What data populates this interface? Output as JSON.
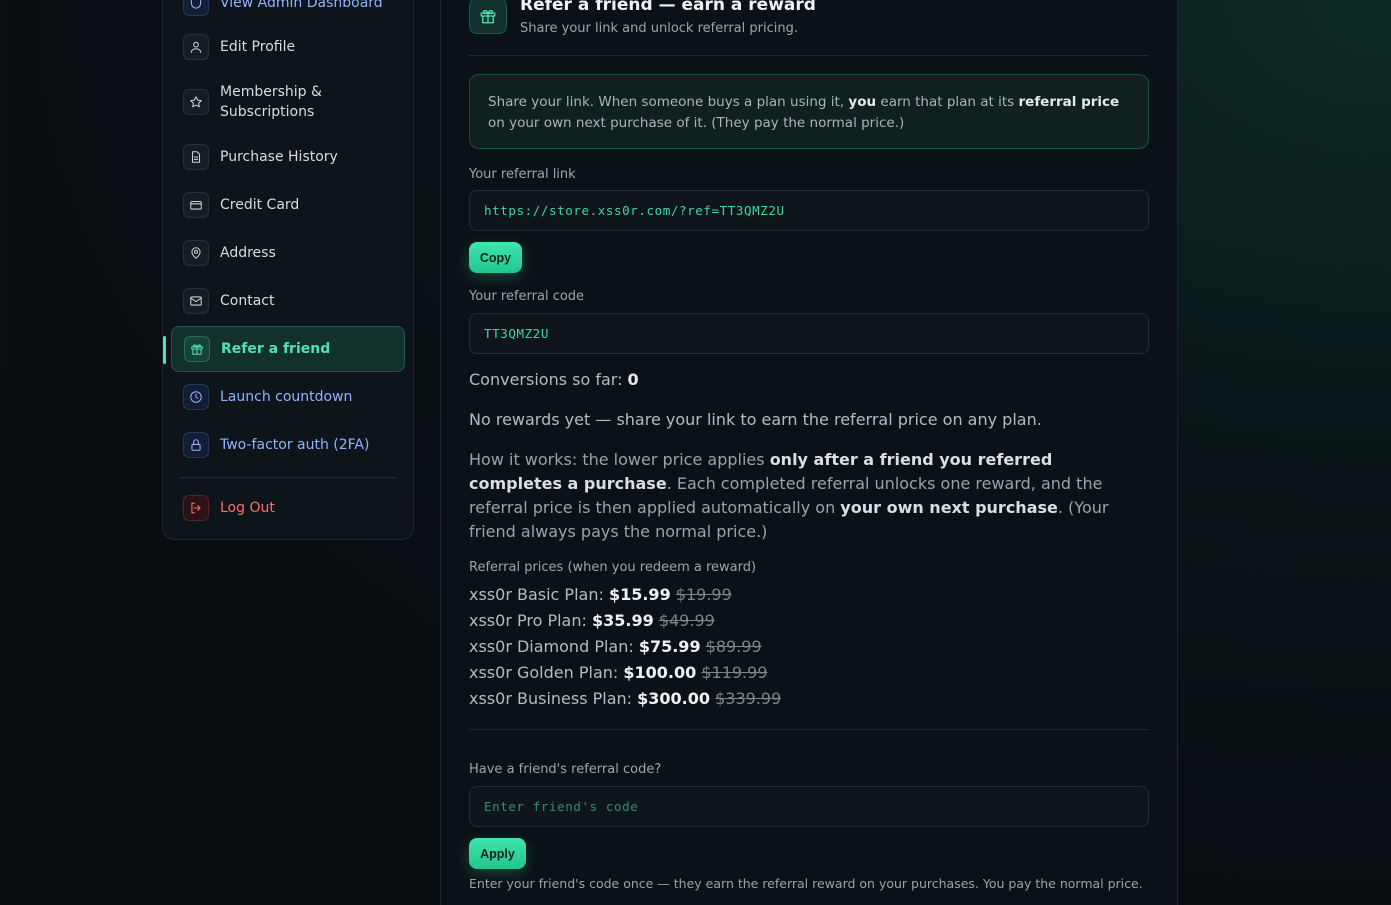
{
  "sidebar": {
    "items": [
      {
        "label": "View Admin Dashboard",
        "icon": "shield-icon"
      },
      {
        "label": "Edit Profile",
        "icon": "user-icon"
      },
      {
        "label": "Membership &",
        "label2": "Subscriptions",
        "icon": "star-icon"
      },
      {
        "label": "Purchase History",
        "icon": "document-icon"
      },
      {
        "label": "Credit Card",
        "icon": "credit-card-icon"
      },
      {
        "label": "Address",
        "icon": "map-pin-icon"
      },
      {
        "label": "Contact",
        "icon": "mail-icon"
      },
      {
        "label": "Refer a friend",
        "icon": "gift-icon"
      },
      {
        "label": "Launch countdown",
        "icon": "clock-icon"
      },
      {
        "label": "Two-factor auth (2FA)",
        "icon": "lock-icon"
      }
    ],
    "logout": {
      "label": "Log Out",
      "icon": "logout-icon"
    }
  },
  "header": {
    "title": "Refer a friend — earn a reward",
    "subtitle": "Share your link and unlock referral pricing."
  },
  "info": {
    "p1": "Share your link. When someone buys a plan using it, ",
    "b1": "you",
    "p2": " earn that plan at its ",
    "b2": "referral price",
    "p3": " on your own next purchase of it. (They pay the normal price.)"
  },
  "referral_link": {
    "label": "Your referral link",
    "value": "https://store.xss0r.com/?ref=TT3QMZ2U",
    "copy_label": "Copy"
  },
  "referral_code": {
    "label": "Your referral code",
    "value": "TT3QMZ2U"
  },
  "conversions": {
    "label": "Conversions so far: ",
    "value": "0"
  },
  "no_rewards": "No rewards yet — share your link to earn the referral price on any plan.",
  "how_it_works": {
    "p1": "How it works: the lower price applies ",
    "b1": "only after a friend you referred completes a purchase",
    "p2": ". Each completed referral unlocks one reward, and the referral price is then applied automatically on ",
    "b2": "your own next purchase",
    "p3": ". (Your friend always pays the normal price.)"
  },
  "prices": {
    "label": "Referral prices (when you redeem a reward)",
    "plans": [
      {
        "name": "xss0r Basic Plan: ",
        "new": "$15.99",
        "old": "$19.99"
      },
      {
        "name": "xss0r Pro Plan: ",
        "new": "$35.99",
        "old": "$49.99"
      },
      {
        "name": "xss0r Diamond Plan: ",
        "new": "$75.99",
        "old": "$89.99"
      },
      {
        "name": "xss0r Golden Plan: ",
        "new": "$100.00",
        "old": "$119.99"
      },
      {
        "name": "xss0r Business Plan: ",
        "new": "$300.00",
        "old": "$339.99"
      }
    ]
  },
  "friend_code": {
    "label": "Have a friend's referral code?",
    "placeholder": "Enter friend's code",
    "apply_label": "Apply",
    "note": "Enter your friend's code once — they earn the referral reward on your purchases. You pay the normal price."
  },
  "colors": {
    "accent": "#3fe6ad",
    "link_blue": "#8fb4ff",
    "danger": "#ff6b6b"
  }
}
